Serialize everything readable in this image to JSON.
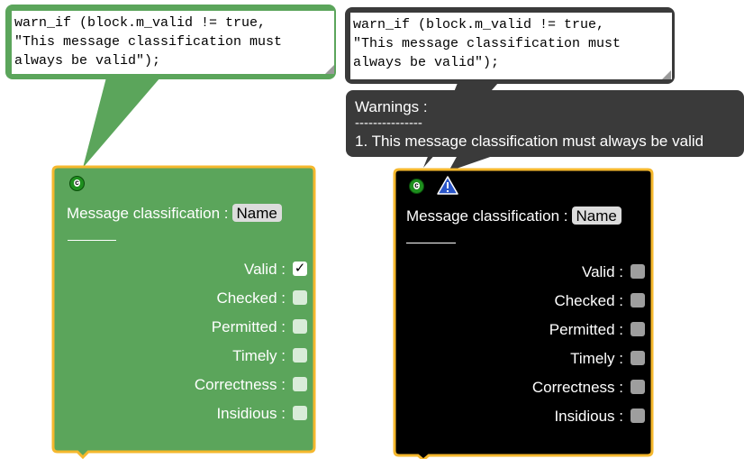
{
  "left_block": {
    "code_line1": "warn_if (block.m_valid != true,",
    "code_line2": "\"This message classification must",
    "code_line3": "always be valid\");",
    "comment_icon": "c",
    "title": "Message classification :",
    "name_field": "Name",
    "fields": [
      {
        "label": "Valid :",
        "checked": true
      },
      {
        "label": "Checked :",
        "checked": false
      },
      {
        "label": "Permitted :",
        "checked": false
      },
      {
        "label": "Timely :",
        "checked": false
      },
      {
        "label": "Correctness :",
        "checked": false
      },
      {
        "label": "Insidious :",
        "checked": false
      }
    ],
    "block_color": "#5ba55b",
    "border_color": "#f5b82e"
  },
  "right_block": {
    "code_line1": "warn_if (block.m_valid != true,",
    "code_line2": "\"This message classification must",
    "code_line3": "always be valid\");",
    "comment_icon": "c",
    "warnings_title": "Warnings :",
    "warnings_separator": "---------------",
    "warning_1": "1. This message classification must always be valid",
    "title": "Message classification :",
    "name_field": "Name",
    "fields": [
      {
        "label": "Valid :",
        "checked": false
      },
      {
        "label": "Checked :",
        "checked": false
      },
      {
        "label": "Permitted :",
        "checked": false
      },
      {
        "label": "Timely :",
        "checked": false
      },
      {
        "label": "Correctness :",
        "checked": false
      },
      {
        "label": "Insidious :",
        "checked": false
      }
    ],
    "block_color": "#000000",
    "border_color": "#f5b82e"
  }
}
